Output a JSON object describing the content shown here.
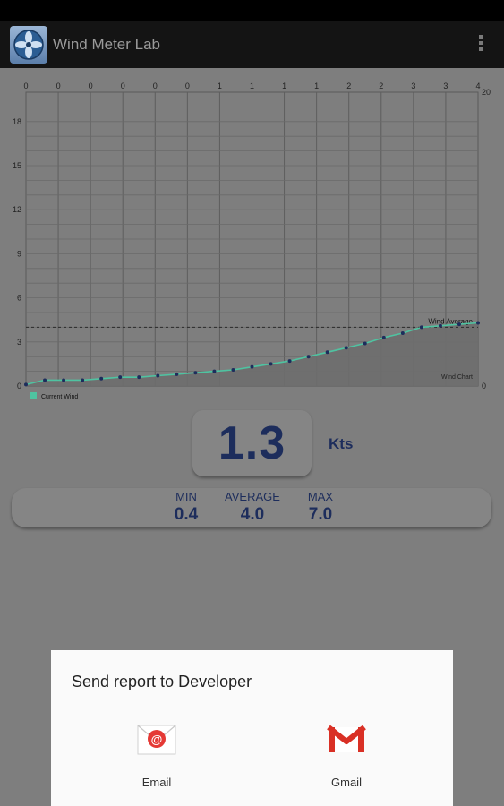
{
  "app": {
    "title": "Wind Meter Lab",
    "icon": "fan-icon"
  },
  "chart_data": {
    "type": "line",
    "title": "Wind Chart",
    "top_tick_labels": [
      "0",
      "0",
      "0",
      "0",
      "0",
      "0",
      "1",
      "1",
      "1",
      "1",
      "2",
      "2",
      "3",
      "3",
      "4"
    ],
    "left_tick_labels": [
      "0",
      "3",
      "6",
      "9",
      "12",
      "15",
      "18"
    ],
    "right_tick_labels": [
      "20",
      "0"
    ],
    "ylim": [
      0,
      20
    ],
    "legend": [
      {
        "name": "Current Wind",
        "color": "#4fc3a1"
      }
    ],
    "reference_line": {
      "name": "Wind Average",
      "value": 4.0
    },
    "series": [
      {
        "name": "Current Wind",
        "color": "#4fc3a1",
        "values": [
          0.1,
          0.4,
          0.4,
          0.4,
          0.5,
          0.6,
          0.6,
          0.7,
          0.8,
          0.9,
          1.0,
          1.1,
          1.3,
          1.5,
          1.7,
          2.0,
          2.3,
          2.6,
          2.9,
          3.3,
          3.6,
          4.0,
          4.1,
          4.2,
          4.3
        ]
      }
    ],
    "grid": true
  },
  "readout": {
    "value": "1.3",
    "unit": "Kts"
  },
  "stats": {
    "min": {
      "label": "MIN",
      "value": "0.4"
    },
    "average": {
      "label": "AVERAGE",
      "value": "4.0"
    },
    "max": {
      "label": "MAX",
      "value": "7.0"
    }
  },
  "dialog": {
    "title": "Send report to Developer",
    "options": [
      {
        "label": "Email",
        "icon": "email-icon"
      },
      {
        "label": "Gmail",
        "icon": "gmail-icon"
      }
    ]
  }
}
